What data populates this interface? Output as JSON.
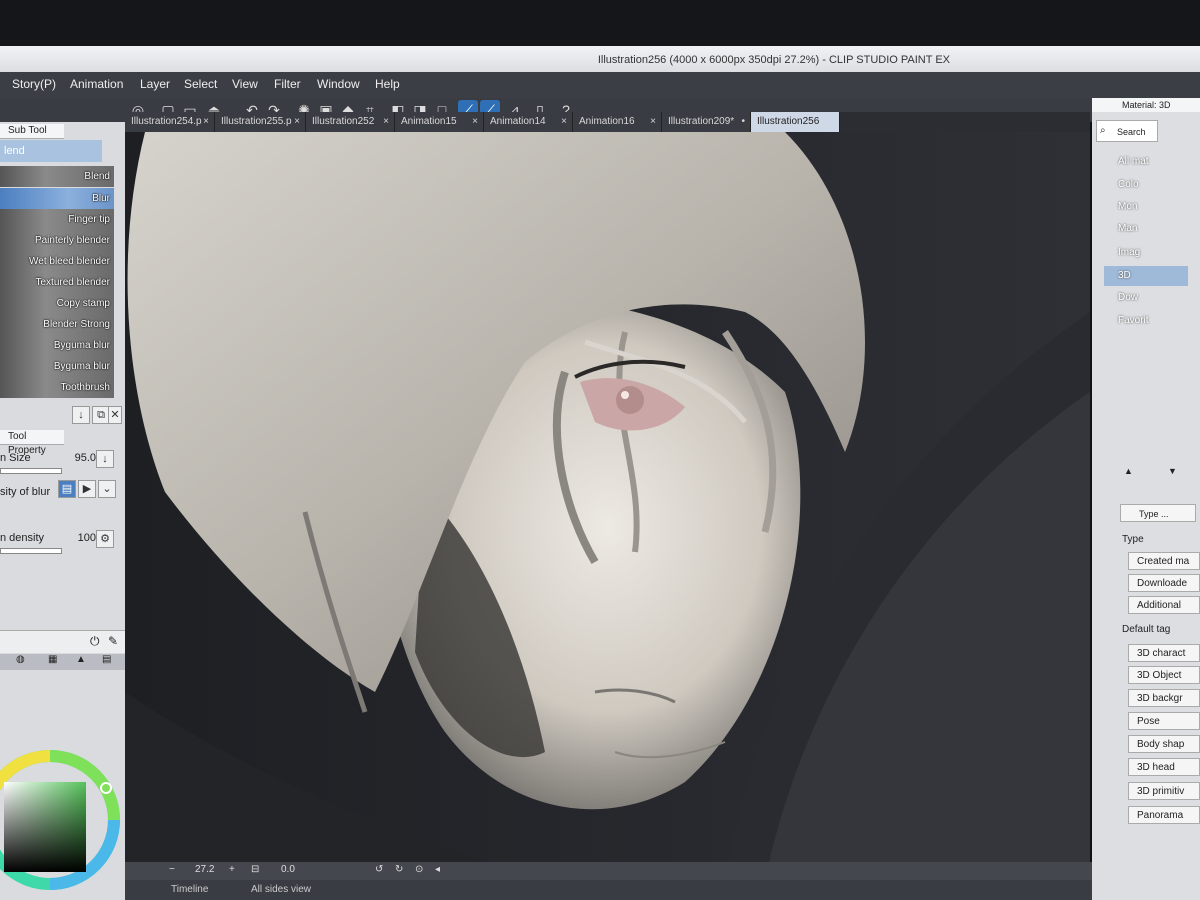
{
  "window": {
    "title": "Illustration256 (4000 x 6000px 350dpi 27.2%)  - CLIP STUDIO PAINT EX"
  },
  "menu": [
    "Story(P)",
    "Animation",
    "Layer",
    "Select",
    "View",
    "Filter",
    "Window",
    "Help"
  ],
  "tabs": [
    {
      "label": "Illustration254.p",
      "close": "×"
    },
    {
      "label": "Illustration255.p",
      "close": "×"
    },
    {
      "label": "Illustration252",
      "close": "×"
    },
    {
      "label": "Animation15",
      "close": "×"
    },
    {
      "label": "Animation14",
      "close": "×"
    },
    {
      "label": "Animation16",
      "close": "×"
    },
    {
      "label": "Illustration209*",
      "close": "•"
    },
    {
      "label": "Illustration256",
      "close": ""
    }
  ],
  "subtool": {
    "header": "Sub Tool",
    "group": "lend",
    "brushes": [
      "Blend",
      "Blur",
      "Finger tip",
      "Painterly blender",
      "Wet bleed blender",
      "Textured blender",
      "Copy stamp",
      "Blender Strong",
      "Byguma blur",
      "Byguma blur",
      "Toothbrush"
    ]
  },
  "tool_property": {
    "header": "Tool Property",
    "brush_size_label": "n Size",
    "brush_size_value": "95.0",
    "blur_label": "sity of blur",
    "density_label": "n density",
    "density_value": "100"
  },
  "statusbar": {
    "zoom": "27.2",
    "angle": "0.0"
  },
  "bottom_tabs": [
    "Timeline",
    "All sides view"
  ],
  "material": {
    "header": "Material: 3D",
    "search": "Search",
    "tree": [
      "All mat",
      "Colo",
      "Mon",
      "Man",
      "Imag",
      "3D",
      "Dow",
      "Favorit"
    ],
    "selected": "3D",
    "type_search": "Type ...",
    "type_label": "Type",
    "type_tags": [
      "Created ma",
      "Downloade",
      "Additional"
    ],
    "default_tag_label": "Default tag",
    "default_tags": [
      "3D charact",
      "3D Object",
      "3D backgr",
      "Pose",
      "Body shap",
      "3D head",
      "3D primitiv",
      "Panorama"
    ]
  },
  "colors": {
    "accent": "#2e6fb6",
    "selection": "#9fb9d8",
    "panel_bg": "#dadbde"
  }
}
